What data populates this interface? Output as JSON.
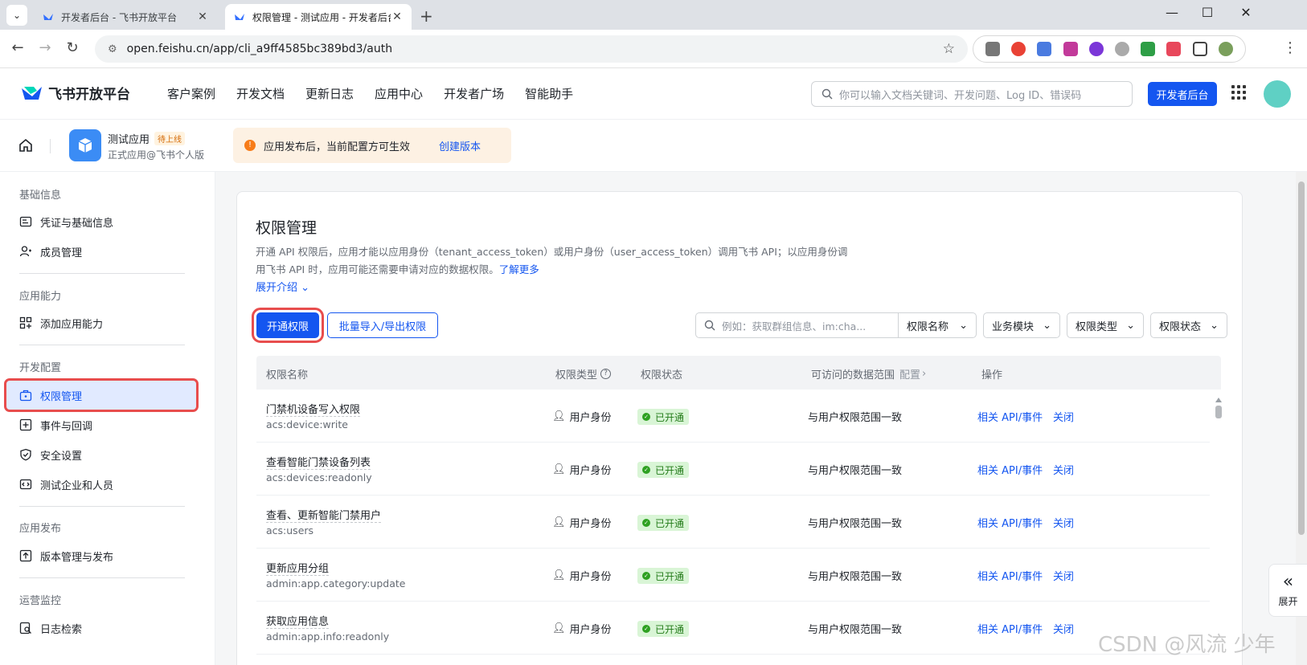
{
  "browser": {
    "tabs": [
      {
        "label": "开发者后台 - 飞书开放平台"
      },
      {
        "label": "权限管理 - 测试应用 - 开发者后台"
      }
    ],
    "url": "open.feishu.cn/app/cli_a9ff4585bc389bd3/auth"
  },
  "header": {
    "logo_text": "飞书开放平台",
    "nav": [
      "客户案例",
      "开发文档",
      "更新日志",
      "应用中心",
      "开发者广场",
      "智能助手"
    ],
    "search_placeholder": "你可以输入文档关键词、开发问题、Log ID、错误码",
    "dev_button": "开发者后台"
  },
  "appbar": {
    "app_name": "测试应用",
    "app_badge": "待上线",
    "app_sub": "正式应用@飞书个人版",
    "notice_text": "应用发布后，当前配置方可生效",
    "notice_link": "创建版本"
  },
  "sidebar": {
    "groups": [
      {
        "title": "基础信息",
        "items": [
          "凭证与基础信息",
          "成员管理"
        ]
      },
      {
        "title": "应用能力",
        "items": [
          "添加应用能力"
        ]
      },
      {
        "title": "开发配置",
        "items": [
          "权限管理",
          "事件与回调",
          "安全设置",
          "测试企业和人员"
        ]
      },
      {
        "title": "应用发布",
        "items": [
          "版本管理与发布"
        ]
      },
      {
        "title": "运营监控",
        "items": [
          "日志检索"
        ]
      }
    ]
  },
  "page": {
    "title": "权限管理",
    "desc_line1": "开通 API 权限后，应用才能以应用身份（tenant_access_token）或用户身份（user_access_token）调用飞书 API；以应用身份调",
    "desc_line2": "用飞书 API 时，应用可能还需要申请对应的数据权限。",
    "desc_link": "了解更多",
    "expand": "展开介绍",
    "btn_enable": "开通权限",
    "btn_batch": "批量导入/导出权限",
    "filter_placeholder": "例如：获取群组信息、im:cha...",
    "filters": [
      "权限名称",
      "业务模块",
      "权限类型",
      "权限状态"
    ]
  },
  "table": {
    "headers": {
      "name": "权限名称",
      "type": "权限类型",
      "status": "权限状态",
      "scope": "可访问的数据范围",
      "scope_config": "配置",
      "action": "操作"
    },
    "rows": [
      {
        "name": "门禁机设备写入权限",
        "code": "acs:device:write",
        "type": "用户身份",
        "status": "已开通",
        "scope": "与用户权限范围一致",
        "api": "相关 API/事件",
        "close": "关闭"
      },
      {
        "name": "查看智能门禁设备列表",
        "code": "acs:devices:readonly",
        "type": "用户身份",
        "status": "已开通",
        "scope": "与用户权限范围一致",
        "api": "相关 API/事件",
        "close": "关闭"
      },
      {
        "name": "查看、更新智能门禁用户",
        "code": "acs:users",
        "type": "用户身份",
        "status": "已开通",
        "scope": "与用户权限范围一致",
        "api": "相关 API/事件",
        "close": "关闭"
      },
      {
        "name": "更新应用分组",
        "code": "admin:app.category:update",
        "type": "用户身份",
        "status": "已开通",
        "scope": "与用户权限范围一致",
        "api": "相关 API/事件",
        "close": "关闭"
      },
      {
        "name": "获取应用信息",
        "code": "admin:app.info:readonly",
        "type": "用户身份",
        "status": "已开通",
        "scope": "与用户权限范围一致",
        "api": "相关 API/事件",
        "close": "关闭"
      }
    ]
  },
  "side_collapse_label": "展开",
  "watermark": "CSDN @风流 少年",
  "colors": {
    "brand": "#1456f0",
    "status_green": "#2ea121",
    "highlight_red": "#e84d4d"
  }
}
